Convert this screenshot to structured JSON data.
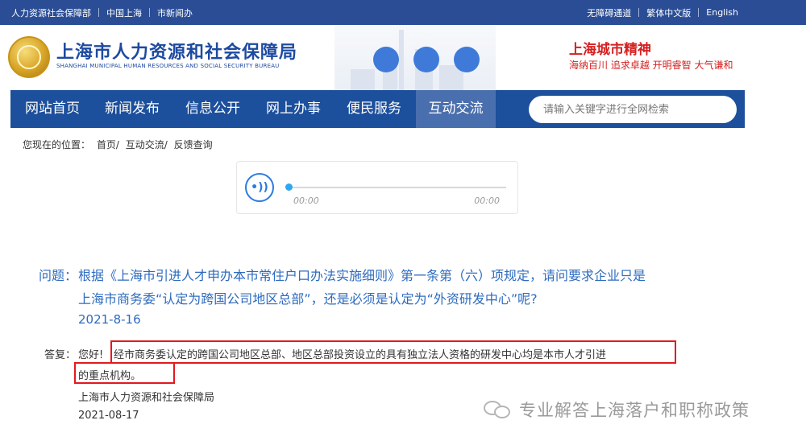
{
  "topbar": {
    "left_links": [
      "人力资源社会保障部",
      "中国上海",
      "市新闻办"
    ],
    "right_links": [
      "无障碍通道",
      "繁体中文版",
      "English"
    ]
  },
  "header": {
    "title_cn": "上海市人力资源和社会保障局",
    "title_en": "SHANGHAI MUNICIPAL HUMAN RESOURCES AND SOCIAL SECURITY BUREAU",
    "spirit_title": "上海城市精神",
    "spirit_words": "海纳百川  追求卓越  开明睿智  大气谦和"
  },
  "nav": {
    "items": [
      "网站首页",
      "新闻发布",
      "信息公开",
      "网上办事",
      "便民服务",
      "互动交流"
    ],
    "active_index": 5,
    "search_placeholder": "请输入关键字进行全网检索"
  },
  "breadcrumb": {
    "prefix": "您现在的位置：",
    "items": [
      "首页/",
      "互动交流/",
      "反馈查询"
    ]
  },
  "player": {
    "current_time": "00:00",
    "total_time": "00:00",
    "progress": 0
  },
  "qa": {
    "question_label": "问题：",
    "question_line1": "根据《上海市引进人才申办本市常住户口办法实施细则》第一条第（六）项规定，请问要求企业只是",
    "question_line2": "上海市商务委“认定为跨国公司地区总部”，还是必须是认定为“外资研发中心”呢?",
    "question_date": "2021-8-16",
    "answer_label": "答复：",
    "answer_greeting": "您好!",
    "answer_line1": "经市商务委认定的跨国公司地区总部、地区总部投资设立的具有独立法人资格的研发中心均是本市人才引进",
    "answer_line2": "的重点机构。",
    "answer_signature": "上海市人力资源和社会保障局",
    "answer_date": "2021-08-17"
  },
  "watermark": {
    "text": "专业解答上海落户和职称政策",
    "icon": "wechat-icon"
  },
  "colors": {
    "topbar": "#2a4d95",
    "nav": "#1c4f9c",
    "nav_active": "#4a6fae",
    "question_text": "#2e6bbf",
    "highlight_box": "#e3191f",
    "spirit": "#d62020"
  }
}
